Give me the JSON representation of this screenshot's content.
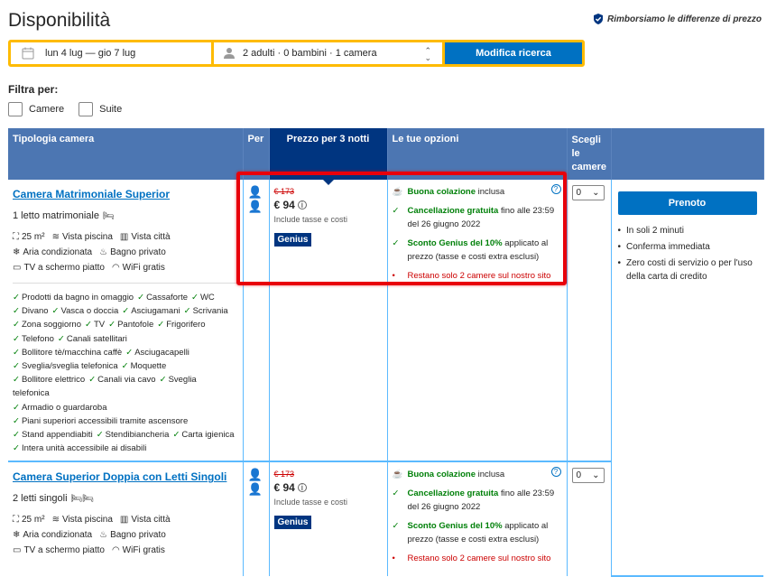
{
  "header": {
    "title": "Disponibilità",
    "refund_text": "Rimborsiamo le differenze di prezzo"
  },
  "search": {
    "dates": "lun 4 lug — gio 7 lug",
    "guests": "2 adulti · 0 bambini · 1 camera",
    "button": "Modifica ricerca"
  },
  "filters": {
    "label": "Filtra per:",
    "options": [
      "Camere",
      "Suite"
    ]
  },
  "table": {
    "headers": {
      "type": "Tipologia camera",
      "per": "Per",
      "price": "Prezzo per 3 notti",
      "options": "Le tue opzioni",
      "choose": "Scegli le camere"
    },
    "rooms": [
      {
        "name": "Camera Matrimoniale Superior",
        "beds": "1 letto matrimoniale",
        "features": {
          "size": "25 m²",
          "pool": "Vista piscina",
          "city": "Vista città",
          "ac": "Aria condizionata",
          "bath": "Bagno privato",
          "tv": "TV a schermo piatto",
          "wifi": "WiFi gratis"
        },
        "amenities": [
          [
            "Prodotti da bagno in omaggio",
            "Cassaforte",
            "WC"
          ],
          [
            "Divano",
            "Vasca o doccia",
            "Asciugamani",
            "Scrivania"
          ],
          [
            "Zona soggiorno",
            "TV",
            "Pantofole",
            "Frigorifero"
          ],
          [
            "Telefono",
            "Canali satellitari"
          ],
          [
            "Bollitore tè/macchina caffè",
            "Asciugacapelli"
          ],
          [
            "Sveglia/sveglia telefonica",
            "Moquette"
          ],
          [
            "Bollitore elettrico",
            "Canali via cavo",
            "Sveglia telefonica"
          ],
          [
            "Armadio o guardaroba"
          ],
          [
            "Piani superiori accessibili tramite ascensore"
          ],
          [
            "Stand appendiabiti",
            "Stendibiancheria",
            "Carta igienica"
          ],
          [
            "Intera unità accessibile ai disabili"
          ]
        ],
        "old_price": "€ 173",
        "price": "€ 94",
        "taxes": "Include tasse e costi",
        "genius": "Genius",
        "breakfast": "Buona colazione",
        "breakfast_suffix": "inclusa",
        "cancel_bold": "Cancellazione gratuita",
        "cancel_rest": "fino alle 23:59 del 26 giugno 2022",
        "discount_bold": "Sconto Genius del 10%",
        "discount_rest": "applicato al prezzo (tasse e costi extra esclusi)",
        "scarcity": "Restano solo 2 camere sul nostro sito",
        "qty": "0"
      },
      {
        "name": "Camera Superior Doppia con Letti Singoli",
        "beds": "2 letti singoli",
        "features": {
          "size": "25 m²",
          "pool": "Vista piscina",
          "city": "Vista città",
          "ac": "Aria condizionata",
          "bath": "Bagno privato",
          "tv": "TV a schermo piatto",
          "wifi": "WiFi gratis"
        },
        "old_price": "€ 173",
        "price": "€ 94",
        "taxes": "Include tasse e costi",
        "genius": "Genius",
        "breakfast": "Buona colazione",
        "breakfast_suffix": "inclusa",
        "cancel_bold": "Cancellazione gratuita",
        "cancel_rest": "fino alle 23:59 del 26 giugno 2022",
        "discount_bold": "Sconto Genius del 10%",
        "discount_rest": "applicato al prezzo (tasse e costi extra esclusi)",
        "scarcity": "Restano solo 2 camere sul nostro sito",
        "qty": "0"
      }
    ],
    "book": {
      "button": "Prenoto",
      "bullets": [
        "In soli 2 minuti",
        "Conferma immediata",
        "Zero costi di servizio o per l'uso della carta di credito"
      ]
    }
  }
}
